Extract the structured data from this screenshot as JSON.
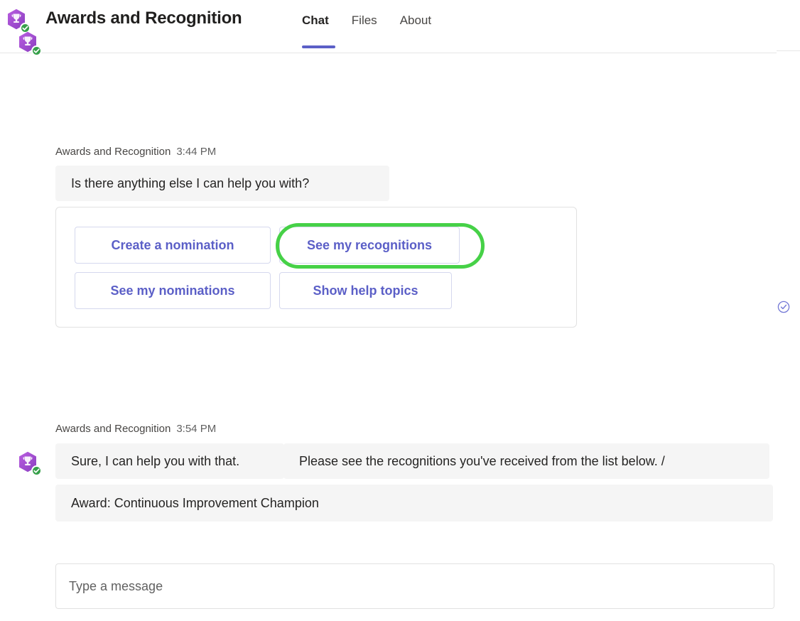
{
  "header": {
    "app_title": "Awards and Recognition",
    "avatar_icon": "trophy-hexagon-icon",
    "presence_icon": "available-check-icon",
    "tabs": [
      {
        "label": "Chat",
        "active": true
      },
      {
        "label": "Files",
        "active": false
      },
      {
        "label": "About",
        "active": false
      }
    ]
  },
  "conversation": {
    "messages": [
      {
        "sender": "Awards and Recognition",
        "time": "3:44 PM",
        "text": "Is there anything else I can help you with?"
      },
      {
        "sender": "Awards and Recognition",
        "time": "3:54 PM",
        "text_part_1": "Sure, I can help you with that.",
        "text_part_2": "Please see the recognitions you've received from the list below. /",
        "text_part_3": "Award: Continuous Improvement Champion"
      }
    ],
    "seen_indicator_icon": "circle-check-icon"
  },
  "suggested_actions": {
    "buttons": [
      {
        "label": "Create a nomination",
        "highlighted": false
      },
      {
        "label": "See my recognitions",
        "highlighted": true
      },
      {
        "label": "See my nominations",
        "highlighted": false
      },
      {
        "label": "Show help topics",
        "highlighted": false
      }
    ]
  },
  "compose": {
    "placeholder": "Type a message",
    "value": ""
  },
  "colors": {
    "accent_purple": "#5b5fc7",
    "highlight_green": "#46d147",
    "presence_green": "#37a04a",
    "bubble_gray": "#f5f5f5",
    "avatar_purple": "#a757d8"
  }
}
